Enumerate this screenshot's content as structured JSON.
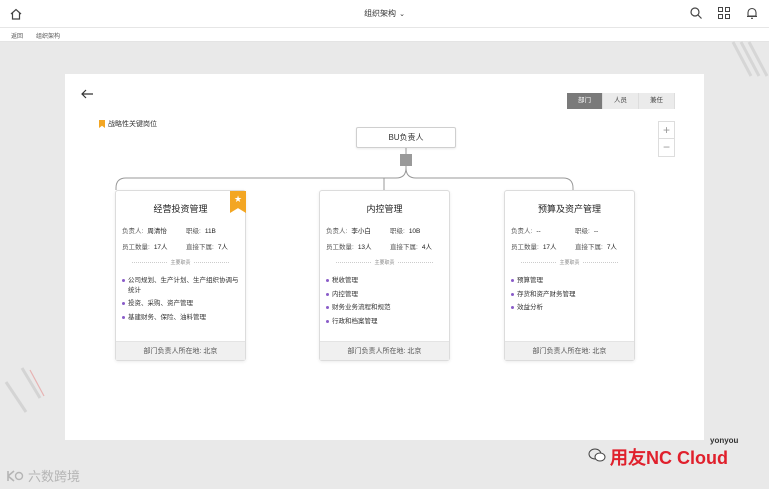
{
  "header": {
    "title": "组织架构"
  },
  "breadcrumb": {
    "back": "返回",
    "current": "组织架构"
  },
  "view_tabs": [
    {
      "label": "部门",
      "active": true
    },
    {
      "label": "人员",
      "active": false
    },
    {
      "label": "兼任",
      "active": false
    }
  ],
  "legend": {
    "label": "战略性关键岗位"
  },
  "zoom": {
    "in": "+",
    "out": "−"
  },
  "root": {
    "label": "BU负责人"
  },
  "labels": {
    "leader": "负责人:",
    "rank": "职级:",
    "staff": "员工数量:",
    "direct": "直接下属:",
    "duties": "主要职责"
  },
  "cards": [
    {
      "title": "经营投资管理",
      "leader": "周清怡",
      "rank": "11B",
      "staff": "17人",
      "direct": "7人",
      "key_position": true,
      "duties": [
        "公司规划、生产计划、生产组织协调与统计",
        "投资、采购、资产管理",
        "基建财务、保险、油料管理"
      ],
      "footer": "部门负责人所在地: 北京"
    },
    {
      "title": "内控管理",
      "leader": "李小白",
      "rank": "10B",
      "staff": "13人",
      "direct": "4人",
      "key_position": false,
      "duties": [
        "税收管理",
        "内控管理",
        "财务业务流程和规范",
        "行政和档案管理"
      ],
      "footer": "部门负责人所在地: 北京"
    },
    {
      "title": "预算及资产管理",
      "leader": "--",
      "rank": "--",
      "staff": "17人",
      "direct": "7人",
      "key_position": false,
      "duties": [
        "预算管理",
        "存货和资产财务管理",
        "效益分析"
      ],
      "footer": "部门负责人所在地: 北京"
    }
  ],
  "watermark": {
    "left": "六数跨境",
    "brand": "用友NC Cloud",
    "yonyou": "yonyou"
  },
  "colors": {
    "accent_star": "#f3a623",
    "bullet": "#8a5cc9",
    "active_tab": "#7a7a7a"
  }
}
